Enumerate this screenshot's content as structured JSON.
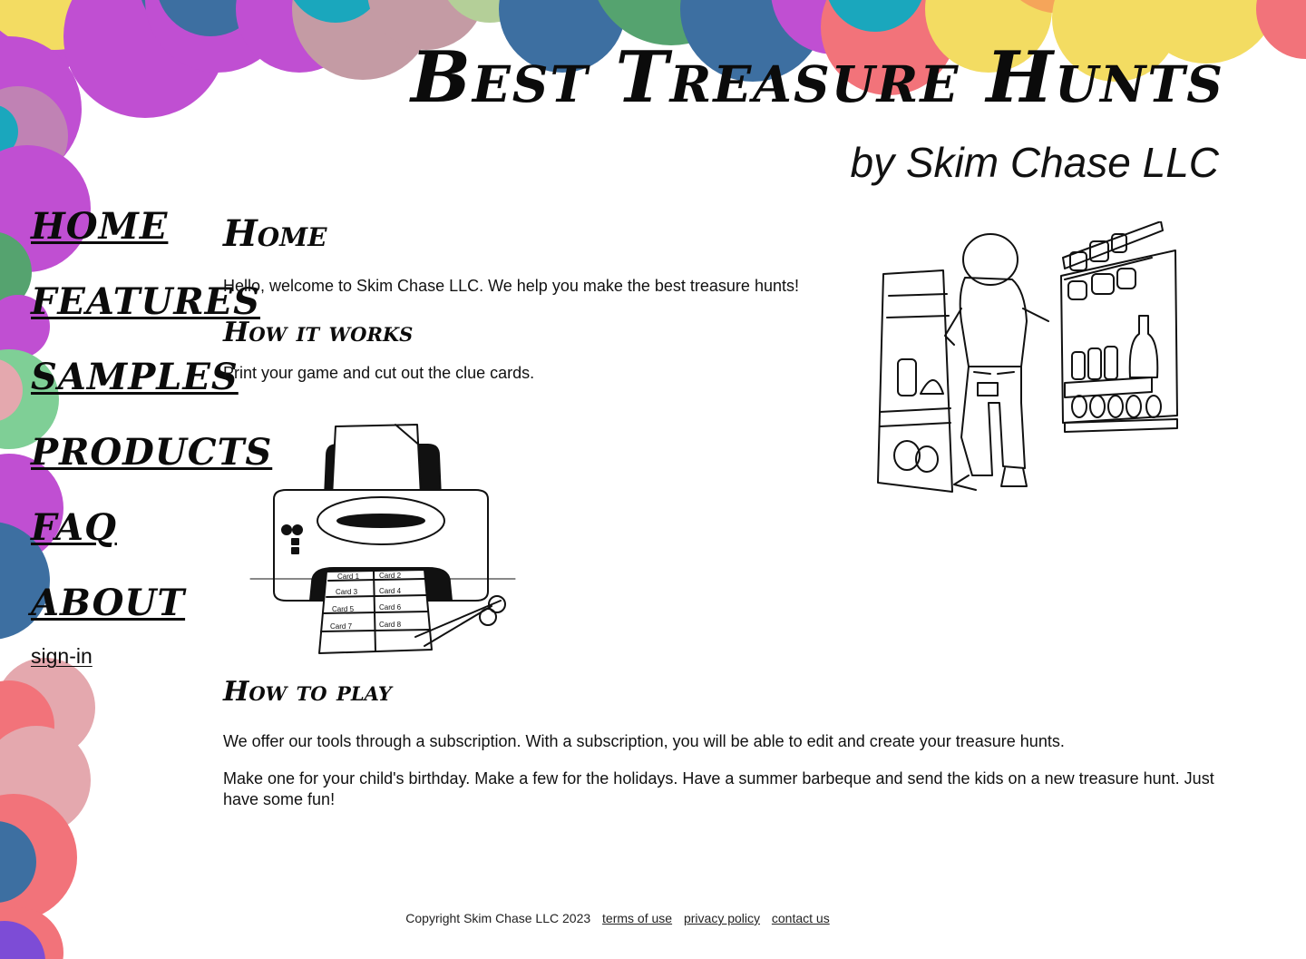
{
  "header": {
    "title": "Best Treasure Hunts",
    "subtitle": "by Skim Chase LLC"
  },
  "nav": {
    "items": [
      "HOME",
      "FEATURES",
      "SAMPLES",
      "PRODUCTS",
      "FAQ",
      "ABOUT"
    ],
    "sign_in": "sign-in"
  },
  "main": {
    "title": "Home",
    "welcome": "Hello, welcome to Skim Chase LLC. We help you make the best treasure hunts!",
    "how_it_works": {
      "heading": "How it works",
      "text": "Print your game and cut out the clue cards."
    },
    "printer_cards": [
      "Card 1",
      "Card 2",
      "Card 3",
      "Card 4",
      "Card 5",
      "Card 6",
      "Card 7",
      "Card 8"
    ],
    "how_to_play": {
      "heading": "How to play",
      "paragraph1": "We offer our tools through a subscription. With a subscription, you will be able to edit and create your treasure hunts.",
      "paragraph2": "Make one for your child's birthday. Make a few for the holidays. Have a summer barbeque and send the kids on a new treasure hunt. Just have some fun!"
    }
  },
  "footer": {
    "copyright": "Copyright Skim Chase LLC 2023",
    "terms": "terms of use",
    "privacy": "privacy policy",
    "contact": "contact us"
  },
  "colors": {
    "magenta": "#c04fd2",
    "mauve": "#c49ba4",
    "blue": "#3d6fa1",
    "green": "#55a36f",
    "teal": "#1aa7bd",
    "coral": "#f2737a",
    "yellow": "#f3dc62",
    "sage": "#b4cf98",
    "pink": "#e4a8ae",
    "mint": "#7fcf96",
    "violet": "#7d4cd6"
  }
}
